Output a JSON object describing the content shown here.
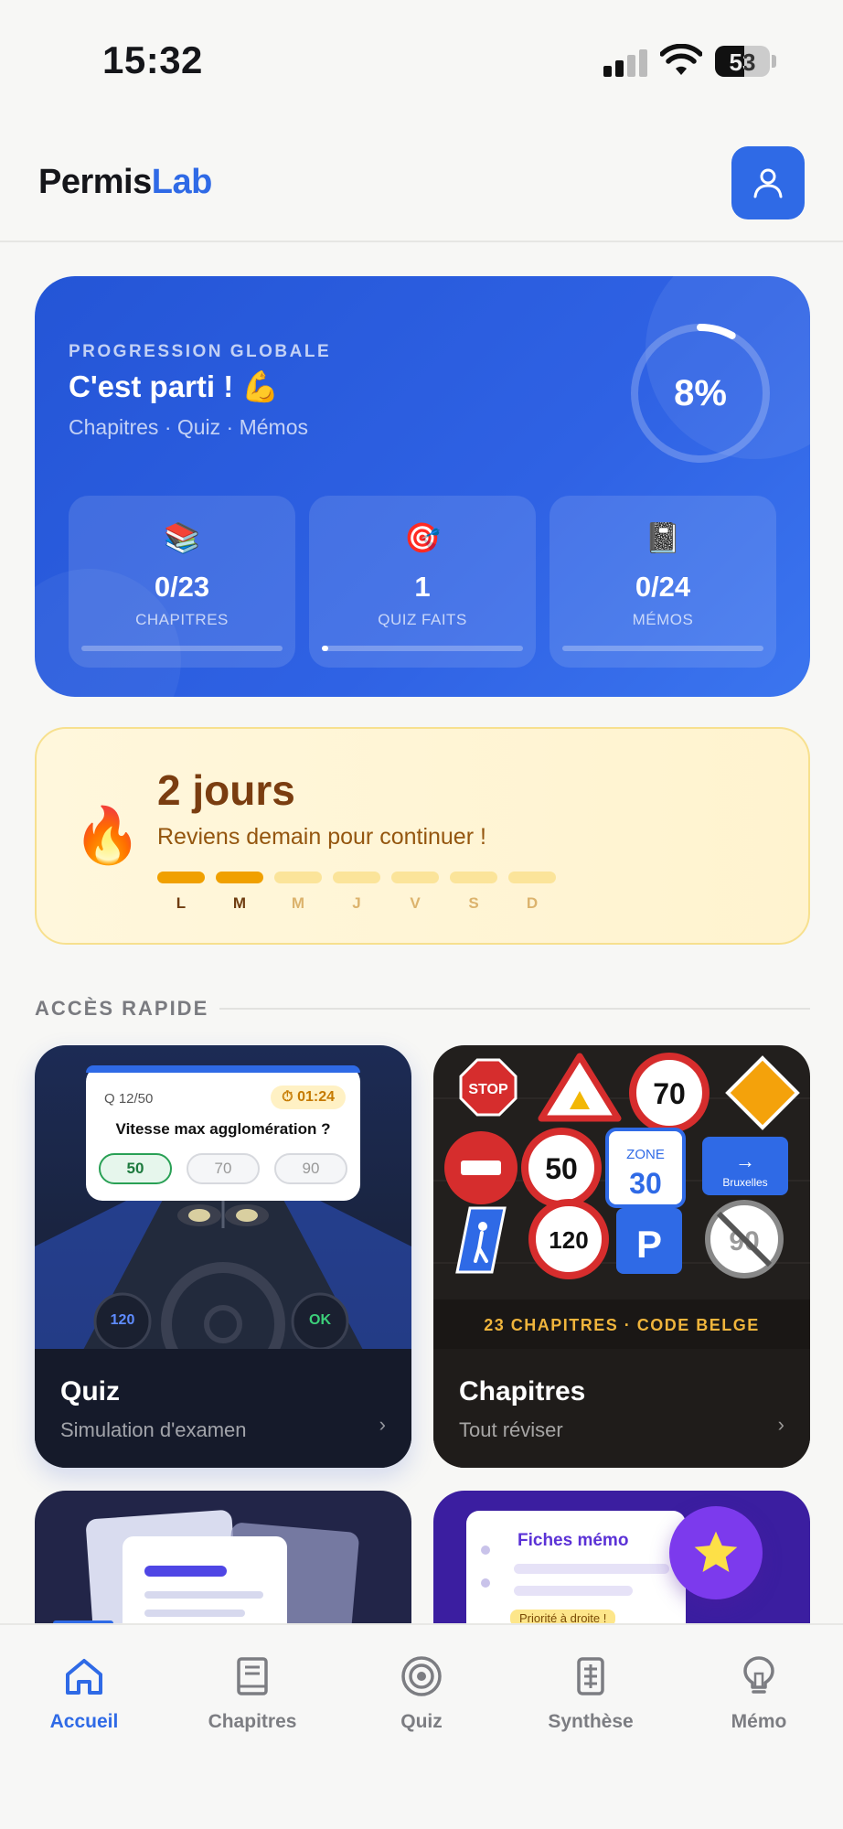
{
  "status": {
    "time": "15:32",
    "battery": "53"
  },
  "header": {
    "logo_part1": "Permis",
    "logo_part2": "Lab"
  },
  "progress": {
    "kicker": "PROGRESSION GLOBALE",
    "title": "C'est parti ! 💪",
    "subtitle": "Chapitres · Quiz · Mémos",
    "percent_label": "8%",
    "percent_value": 8,
    "stats": [
      {
        "emoji": "📚",
        "value": "0/23",
        "label": "CHAPITRES",
        "fill": 0
      },
      {
        "emoji": "🎯",
        "value": "1",
        "label": "QUIZ FAITS",
        "fill": 0.03
      },
      {
        "emoji": "📓",
        "value": "0/24",
        "label": "MÉMOS",
        "fill": 0
      }
    ]
  },
  "streak": {
    "emoji": "🔥",
    "days": "2 jours",
    "message": "Reviens demain pour continuer !",
    "week": [
      {
        "l": "L",
        "done": true
      },
      {
        "l": "M",
        "done": true
      },
      {
        "l": "M",
        "done": false
      },
      {
        "l": "J",
        "done": false
      },
      {
        "l": "V",
        "done": false
      },
      {
        "l": "S",
        "done": false
      },
      {
        "l": "D",
        "done": false
      }
    ]
  },
  "quick": {
    "title": "ACCÈS RAPIDE",
    "quiz": {
      "name": "Quiz",
      "sub": "Simulation d'examen",
      "chev": "›",
      "preview": {
        "qnum": "Q 12/50",
        "timer": "⏱ 01:24",
        "question": "Vitesse max agglomération ?",
        "options": [
          "50",
          "70",
          "90"
        ],
        "gauge_left": "120",
        "gauge_right": "OK"
      }
    },
    "chapters": {
      "name": "Chapitres",
      "sub": "Tout réviser",
      "chev": "›",
      "banner": "23 CHAPITRES · CODE BELGE",
      "signs": {
        "stop": "STOP",
        "s70": "70",
        "s50": "50",
        "zone_top": "ZONE",
        "zone_num": "30",
        "arrow": "→",
        "city": "Bruxelles",
        "s120": "120",
        "park": "P",
        "s90": "90"
      }
    },
    "memo": {
      "card_title": "Fiches mémo",
      "note": "Priorité à droite !"
    }
  },
  "tabs": [
    {
      "label": "Accueil",
      "icon": "home-icon",
      "active": true
    },
    {
      "label": "Chapitres",
      "icon": "book-icon",
      "active": false
    },
    {
      "label": "Quiz",
      "icon": "target-icon",
      "active": false
    },
    {
      "label": "Synthèse",
      "icon": "document-icon",
      "active": false
    },
    {
      "label": "Mémo",
      "icon": "lightbulb-icon",
      "active": false
    }
  ],
  "colors": {
    "accent": "#2f6ae6",
    "streak_on": "#f0a000",
    "purple": "#7c3aed",
    "banner_text": "#f0b53c"
  }
}
